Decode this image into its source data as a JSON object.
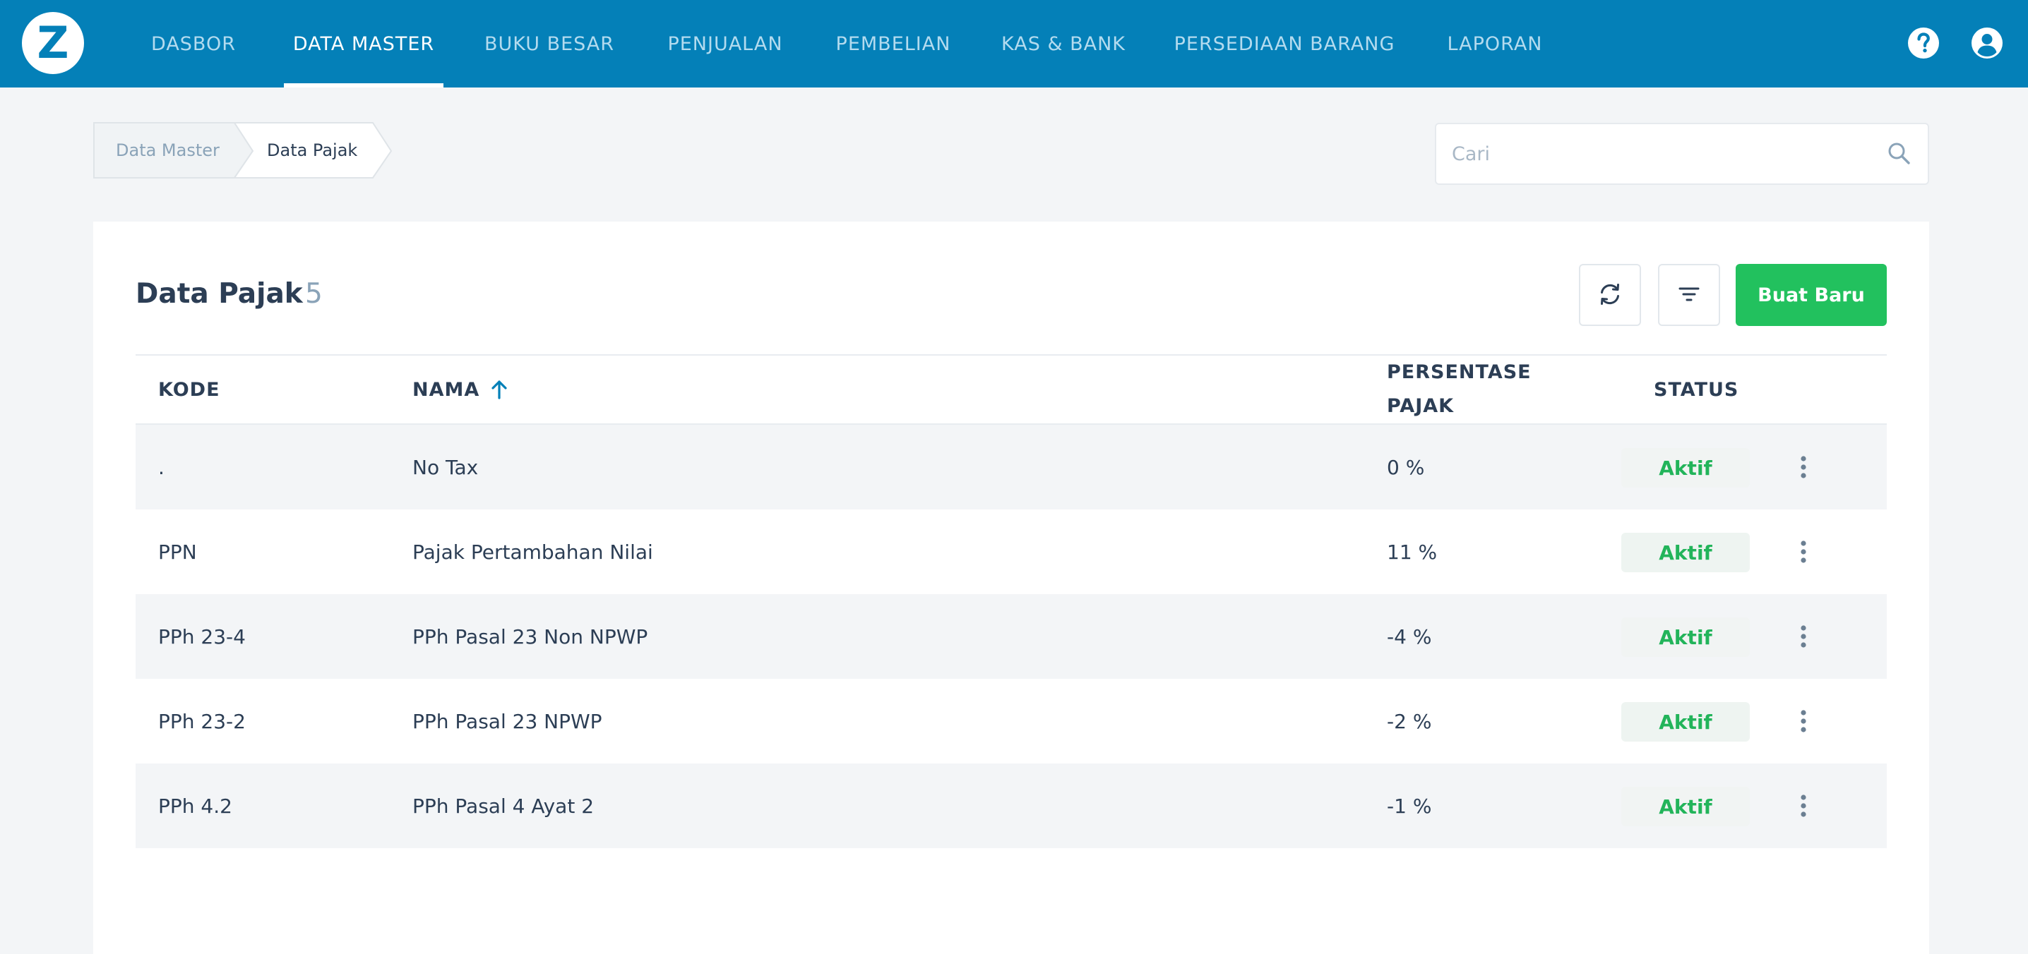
{
  "brand": {
    "logo_letter": "Z"
  },
  "nav": {
    "items": [
      {
        "label": "DASBOR"
      },
      {
        "label": "DATA MASTER"
      },
      {
        "label": "BUKU BESAR"
      },
      {
        "label": "PENJUALAN"
      },
      {
        "label": "PEMBELIAN"
      },
      {
        "label": "KAS & BANK"
      },
      {
        "label": "PERSEDIAAN BARANG"
      },
      {
        "label": "LAPORAN"
      }
    ],
    "active_item": "DATA MASTER",
    "right_icons": [
      "help-icon",
      "account-icon"
    ]
  },
  "breadcrumb": {
    "items": [
      {
        "label": "Data Master"
      },
      {
        "label": "Data Pajak"
      }
    ]
  },
  "search": {
    "placeholder": "Cari",
    "value": ""
  },
  "page": {
    "title": "Data Pajak",
    "count": "5",
    "refresh_icon": "refresh-icon",
    "filter_icon": "filter-icon",
    "create_label": "Buat Baru"
  },
  "table": {
    "columns": {
      "kode": "KODE",
      "nama": "NAMA",
      "persentase_line1": "PERSENTASE",
      "persentase_line2": "PAJAK",
      "status": "STATUS"
    },
    "sorted_by": "NAMA",
    "sort_direction": "ascending",
    "rows": [
      {
        "kode": ".",
        "nama": "No Tax",
        "persentase": "0 %",
        "status": "Aktif"
      },
      {
        "kode": "PPN",
        "nama": "Pajak Pertambahan Nilai",
        "persentase": "11 %",
        "status": "Aktif"
      },
      {
        "kode": "PPh 23-4",
        "nama": "PPh Pasal 23 Non NPWP",
        "persentase": "-4 %",
        "status": "Aktif"
      },
      {
        "kode": "PPh 23-2",
        "nama": "PPh Pasal 23 NPWP",
        "persentase": "-2 %",
        "status": "Aktif"
      },
      {
        "kode": "PPh 4.2",
        "nama": "PPh Pasal 4 Ayat 2",
        "persentase": "-1 %",
        "status": "Aktif"
      }
    ]
  },
  "colors": {
    "nav_bg": "#0480b8",
    "primary_button": "#22c15e",
    "status_active": "#22b45a",
    "page_bg": "#f3f5f7"
  }
}
